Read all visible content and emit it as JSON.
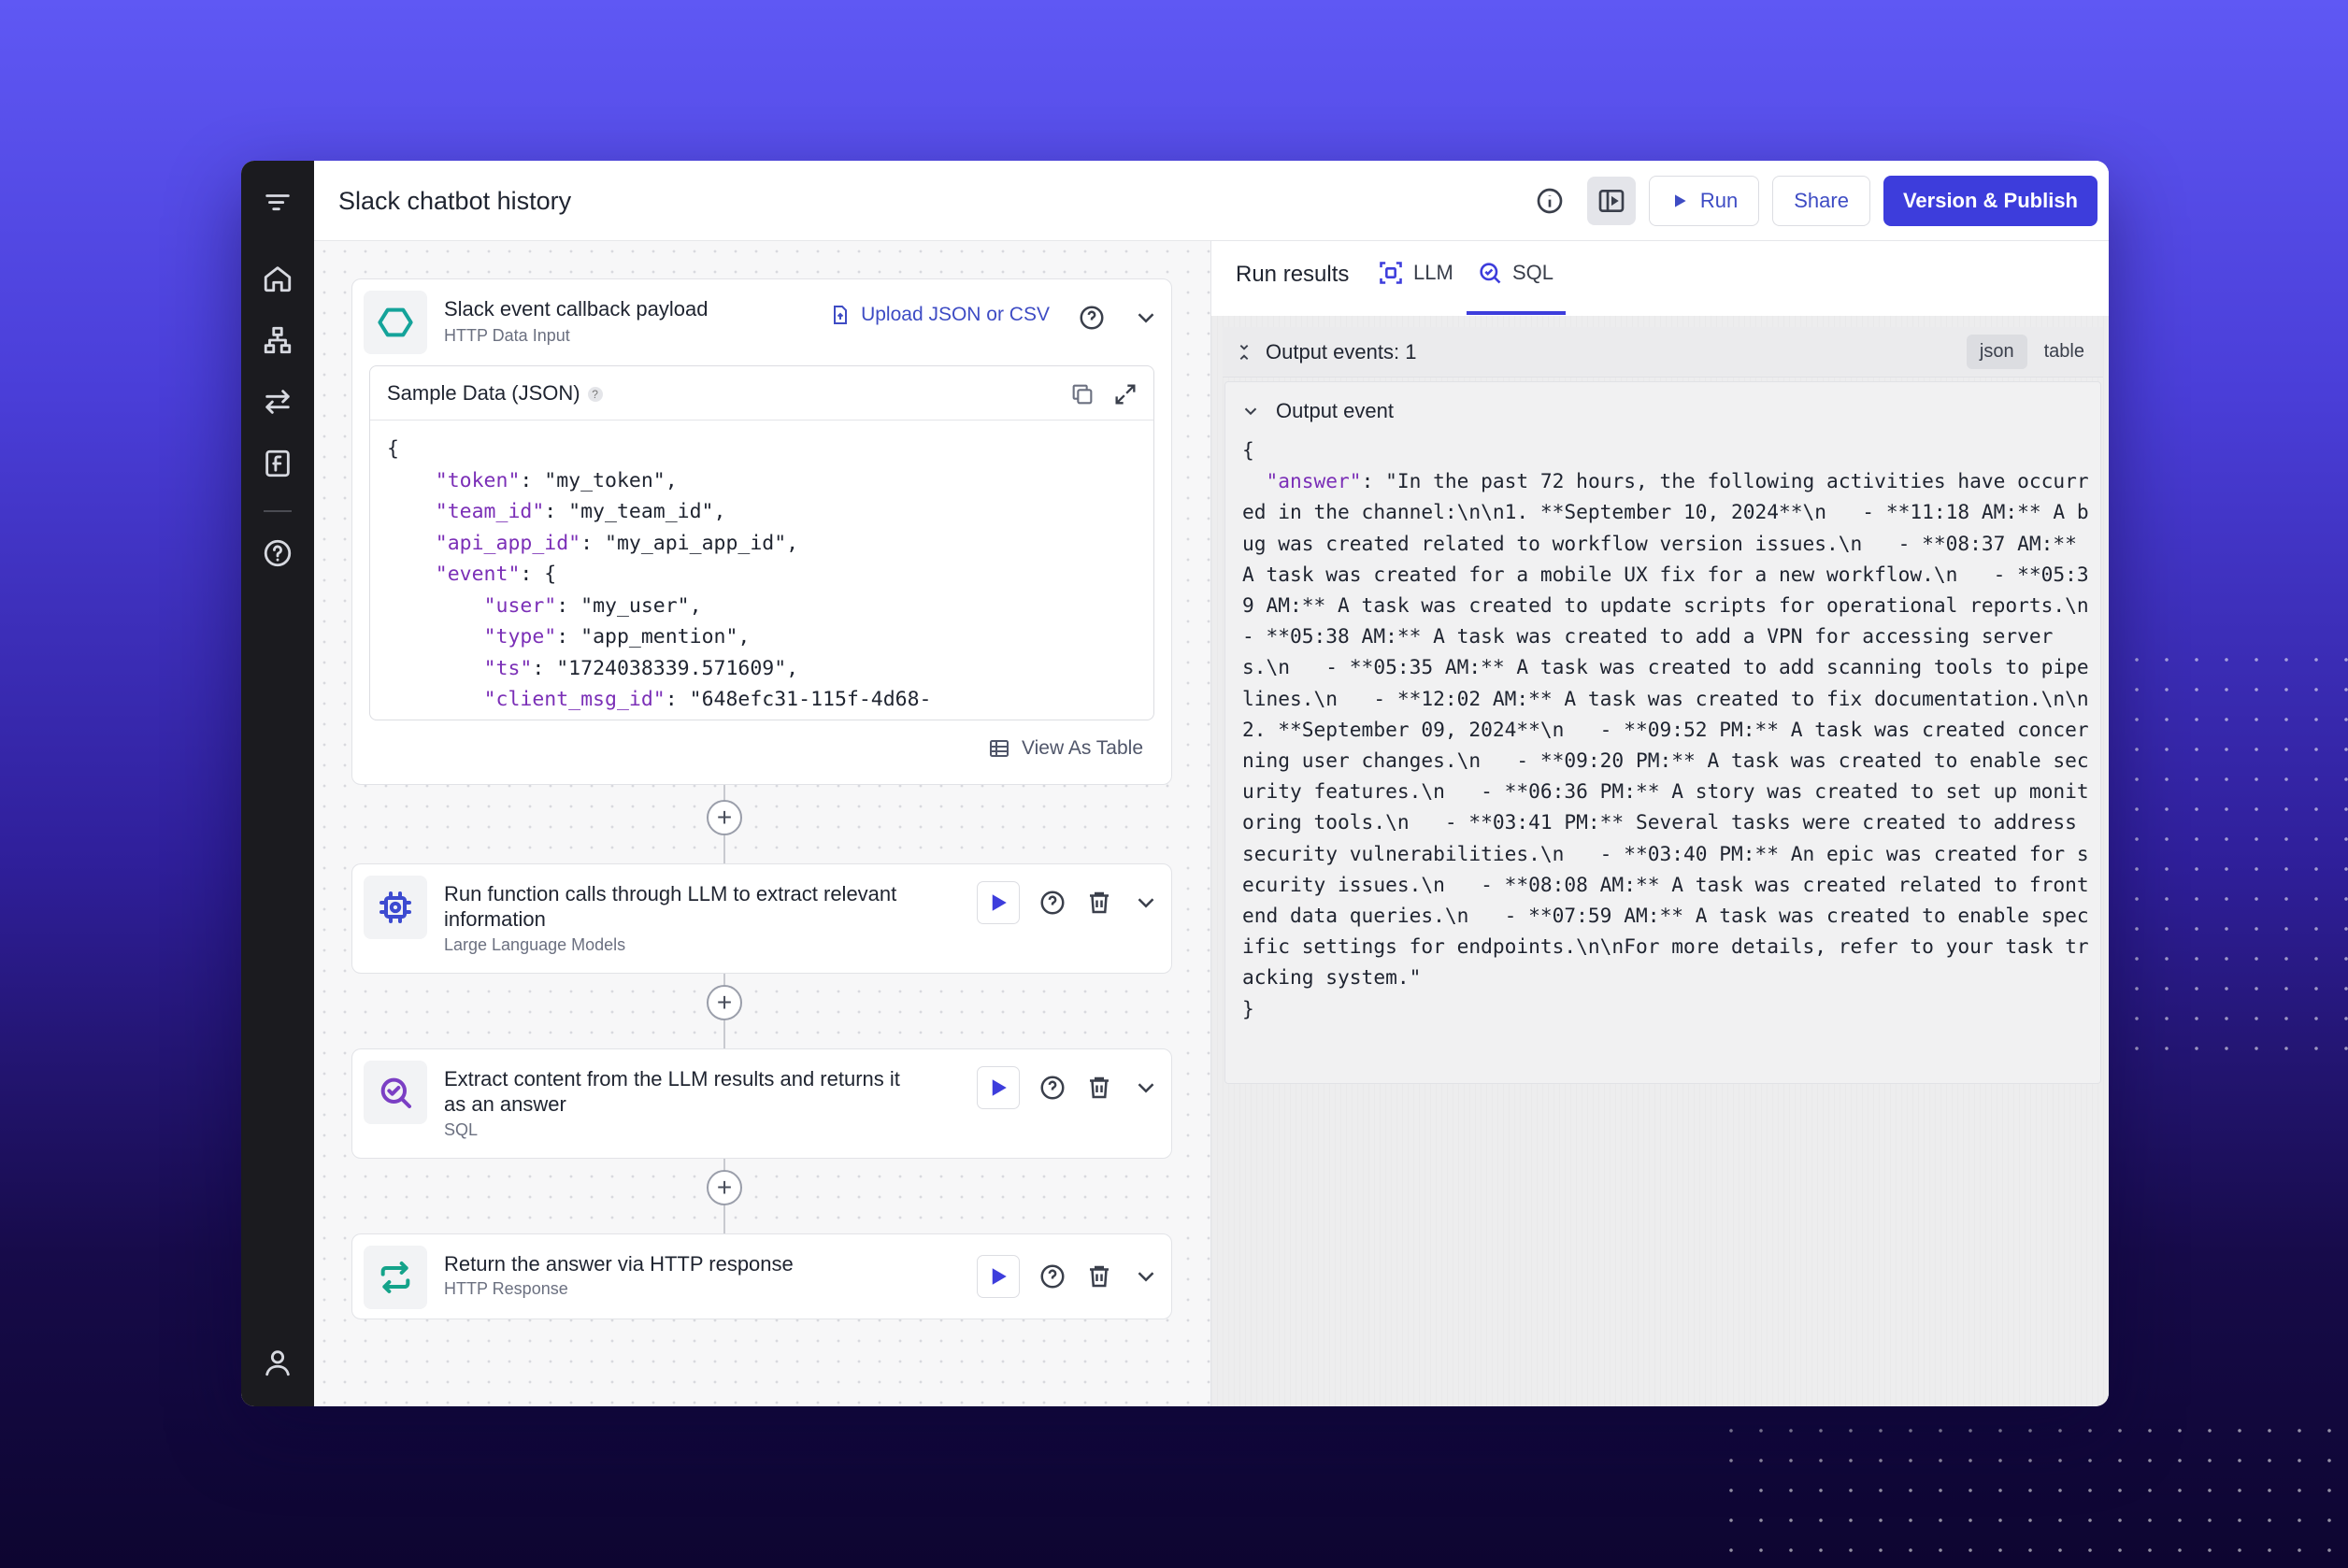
{
  "app": {
    "title": "Slack chatbot history"
  },
  "toolbar": {
    "run_label": "Run",
    "share_label": "Share",
    "publish_label": "Version & Publish"
  },
  "nodes": [
    {
      "title": "Slack event callback payload",
      "subtitle": "HTTP Data Input",
      "upload_label": "Upload JSON or CSV",
      "sample_title": "Sample Data (JSON)",
      "view_table_label": "View As Table",
      "sample_lines": [
        {
          "pre": "{",
          "key": "",
          "val": ""
        },
        {
          "pre": "    ",
          "key": "\"token\"",
          "val": ": \"my_token\","
        },
        {
          "pre": "    ",
          "key": "\"team_id\"",
          "val": ": \"my_team_id\","
        },
        {
          "pre": "    ",
          "key": "\"api_app_id\"",
          "val": ": \"my_api_app_id\","
        },
        {
          "pre": "    ",
          "key": "\"event\"",
          "val": ": {"
        },
        {
          "pre": "        ",
          "key": "\"user\"",
          "val": ": \"my_user\","
        },
        {
          "pre": "        ",
          "key": "\"type\"",
          "val": ": \"app_mention\","
        },
        {
          "pre": "        ",
          "key": "\"ts\"",
          "val": ": \"1724038339.571609\","
        },
        {
          "pre": "        ",
          "key": "\"client_msg_id\"",
          "val": ": \"648efc31-115f-4d68-"
        }
      ]
    },
    {
      "title_line1": "Run function calls through LLM to extract relevant",
      "title_line2": "information",
      "subtitle": "Large Language Models"
    },
    {
      "title_line1": "Extract content from the LLM results and returns it",
      "title_line2": "as an answer",
      "subtitle": "SQL"
    },
    {
      "title": "Return the answer via HTTP response",
      "subtitle": "HTTP Response"
    }
  ],
  "results": {
    "header": "Run results",
    "tabs": [
      "LLM",
      "SQL"
    ],
    "active_tab": "SQL",
    "output_count_label": "Output events: 1",
    "format_options": [
      "json",
      "table"
    ],
    "active_format": "json",
    "event_title": "Output event",
    "json_open": "{",
    "answer_key": "\"answer\"",
    "answer_value": ": \"In the past 72 hours, the following activities have occurred in the channel:\\n\\n1. **September 10, 2024**\\n   - **11:18 AM:** A bug was created related to workflow version issues.\\n   - **08:37 AM:** A task was created for a mobile UX fix for a new workflow.\\n   - **05:39 AM:** A task was created to update scripts for operational reports.\\n   - **05:38 AM:** A task was created to add a VPN for accessing servers.\\n   - **05:35 AM:** A task was created to add scanning tools to pipelines.\\n   - **12:02 AM:** A task was created to fix documentation.\\n\\n2. **September 09, 2024**\\n   - **09:52 PM:** A task was created concerning user changes.\\n   - **09:20 PM:** A task was created to enable security features.\\n   - **06:36 PM:** A story was created to set up monitoring tools.\\n   - **03:41 PM:** Several tasks were created to address security vulnerabilities.\\n   - **03:40 PM:** An epic was created for security issues.\\n   - **08:08 AM:** A task was created related to frontend data queries.\\n   - **07:59 AM:** A task was created to enable specific settings for endpoints.\\n\\nFor more details, refer to your task tracking system.\"",
    "json_close": "}"
  },
  "colors": {
    "accent": "#3d3ddc",
    "json_key": "#7b2fb7",
    "rail": "#1b1b1f"
  }
}
